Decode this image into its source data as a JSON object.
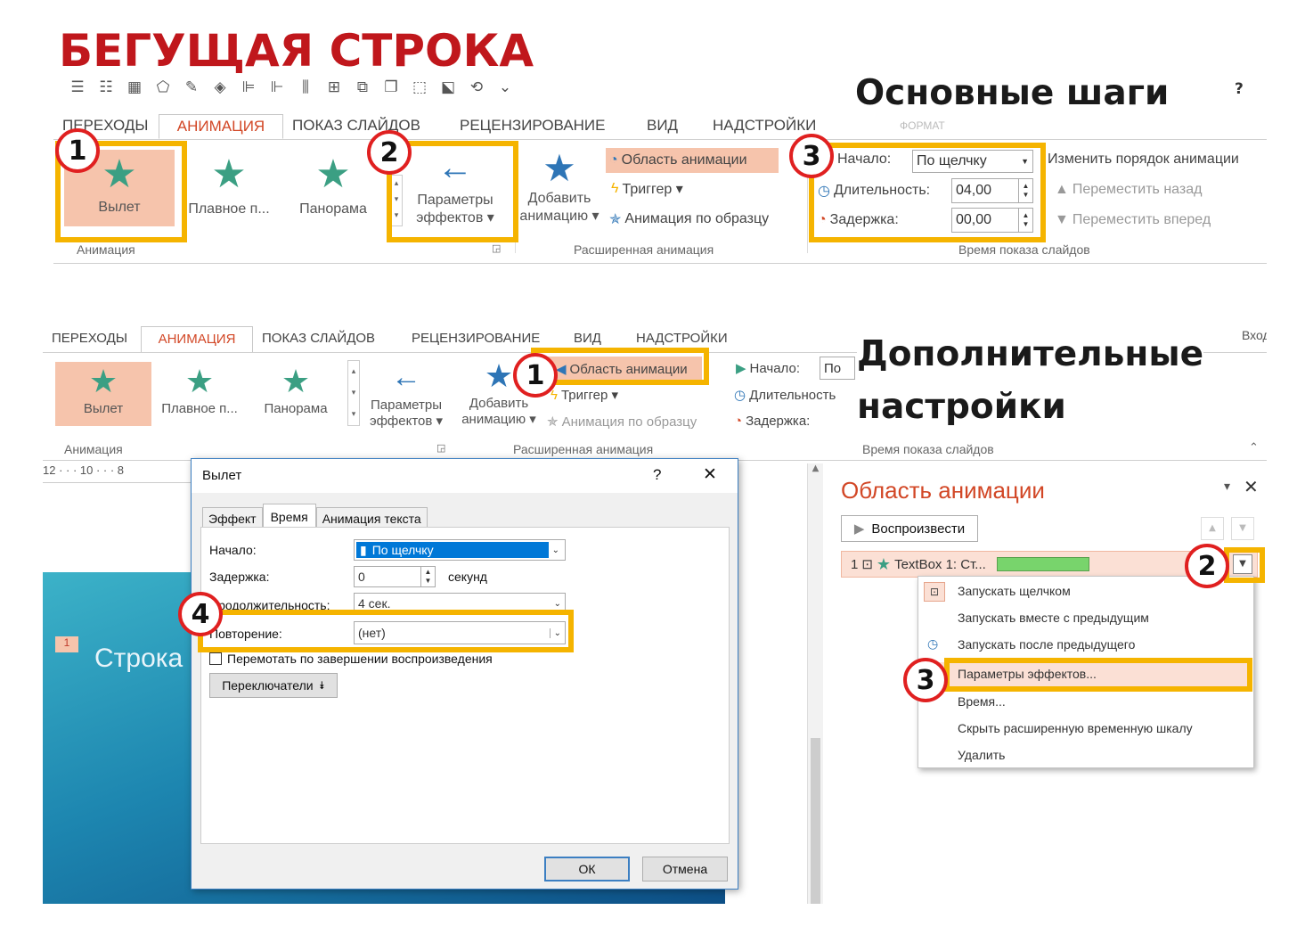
{
  "title": "БЕГУЩАЯ СТРОКА",
  "headings": {
    "main_steps": "Основные шаги",
    "extra_settings_l1": "Дополнительные",
    "extra_settings_l2": "настройки"
  },
  "qat_icons": [
    "bullets-icon",
    "numbering-icon",
    "table-icon",
    "shapes-icon",
    "pen-color-icon",
    "fill-color-icon",
    "align-left-icon",
    "align-obj-icon",
    "distribute-icon",
    "group-icon",
    "arrange-icon",
    "bring-front-icon",
    "send-back-icon",
    "selection-icon",
    "rotate-icon",
    "more-icon"
  ],
  "help": "?",
  "top": {
    "tabs": [
      "ПЕРЕХОДЫ",
      "АНИМАЦИЯ",
      "ПОКАЗ СЛАЙДОВ",
      "РЕЦЕНЗИРОВАНИЕ",
      "ВИД",
      "НАДСТРОЙКИ",
      "ФОРМАТ"
    ],
    "gallery": [
      "Вылет",
      "Плавное п...",
      "Панорама"
    ],
    "effect_options": [
      "Параметры",
      "эффектов ▾"
    ],
    "add_animation": [
      "Добавить",
      "анимацию ▾"
    ],
    "adv": [
      "Область анимации",
      "Триггер ▾",
      "Анимация по образцу"
    ],
    "timing_labels": [
      "Начало:",
      "Длительность:",
      "Задержка:"
    ],
    "timing_values": [
      "По щелчку",
      "04,00",
      "00,00"
    ],
    "reorder": [
      "Изменить порядок анимации",
      "Переместить назад",
      "Переместить вперед"
    ],
    "group_labels": [
      "Анимация",
      "Расширенная анимация",
      "Время показа слайдов"
    ],
    "steps": [
      "1",
      "2",
      "3"
    ]
  },
  "bottom": {
    "tabs": [
      "ПЕРЕХОДЫ",
      "АНИМАЦИЯ",
      "ПОКАЗ СЛАЙДОВ",
      "РЕЦЕНЗИРОВАНИЕ",
      "ВИД",
      "НАДСТРОЙКИ"
    ],
    "signin": "Вход",
    "gallery": [
      "Вылет",
      "Плавное п...",
      "Панорама"
    ],
    "effect_options": [
      "Параметры",
      "эффектов ▾"
    ],
    "add_animation": [
      "Добавить",
      "анимацию ▾"
    ],
    "adv": [
      "Область анимации",
      "Триггер ▾",
      "Анимация по образцу"
    ],
    "timing_labels": [
      "Начало:",
      "Длительность",
      "Задержка:"
    ],
    "timing_start_value": "По",
    "group_labels": [
      "Анимация",
      "Расширенная анимация",
      "Время показа слайдов"
    ],
    "ruler": "12 · · · 10 · · · 8",
    "slide_text": "Строка",
    "slide_number": "1"
  },
  "dialog": {
    "title": "Вылет",
    "help": "?",
    "close": "✕",
    "tabs": [
      "Эффект",
      "Время",
      "Анимация текста"
    ],
    "rows": [
      {
        "label": "Начало:",
        "value": "По щелчку"
      },
      {
        "label": "Задержка:",
        "value": "0",
        "unit": "секунд"
      },
      {
        "label": "Продолжительность:",
        "value": "4 сек."
      },
      {
        "label": "Повторение:",
        "value": "(нет)"
      }
    ],
    "rewind": "Перемотать по завершении воспроизведения",
    "triggers": "Переключатели",
    "ok": "ОК",
    "cancel": "Отмена",
    "step": "4"
  },
  "pane": {
    "title": "Область анимации",
    "play": "Воспроизвести",
    "item": "TextBox 1: Ст...",
    "item_index": "1",
    "menu": [
      "Запускать щелчком",
      "Запускать вместе с предыдущим",
      "Запускать после предыдущего",
      "Параметры эффектов...",
      "Время...",
      "Скрыть расширенную временную шкалу",
      "Удалить"
    ],
    "steps": [
      "1",
      "2",
      "3"
    ]
  },
  "colors": {
    "title_red": "#c0171c",
    "highlight": "#f5b400",
    "accent_orange": "#d24726",
    "star_green": "#3b9f83"
  }
}
